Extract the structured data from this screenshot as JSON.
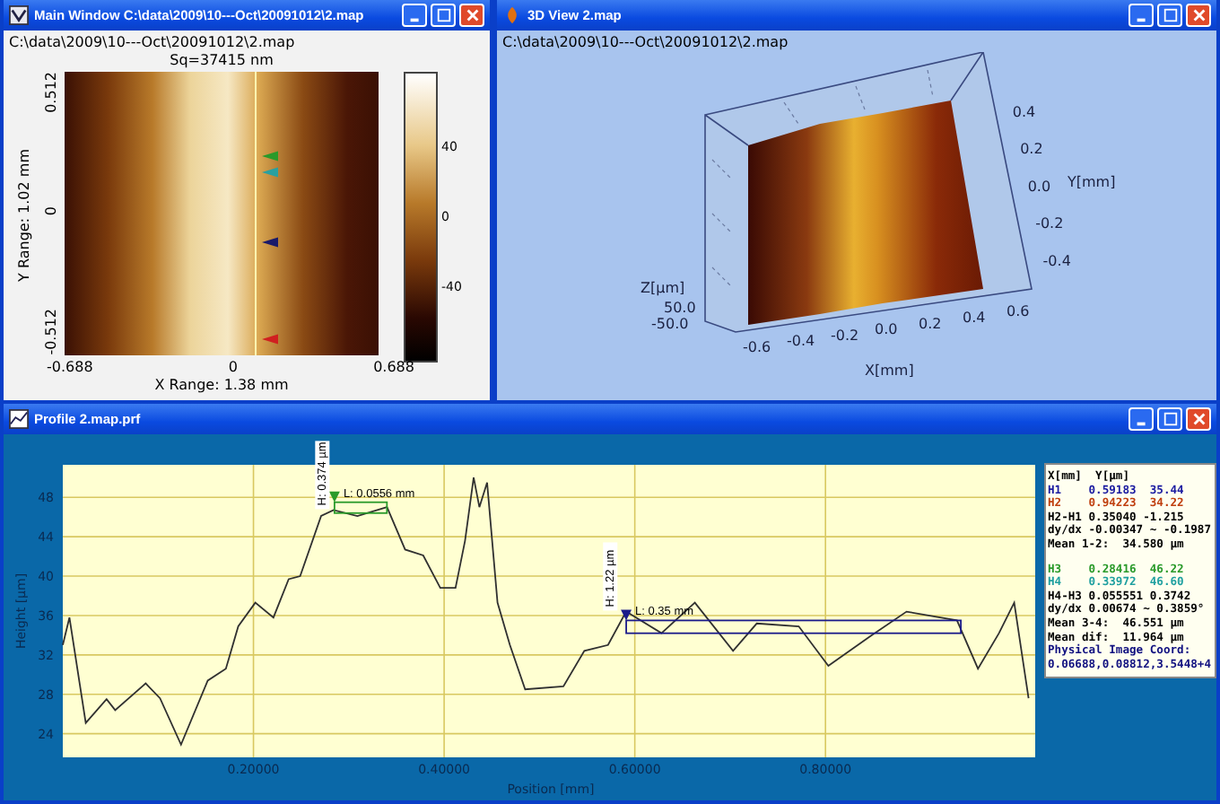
{
  "main_window": {
    "title": "Main Window C:\\data\\2009\\10---Oct\\20091012\\2.map",
    "path": "C:\\data\\2009\\10---Oct\\20091012\\2.map",
    "image_title": "Sq=37415 nm",
    "y_axis_label": "Y Range: 1.02 mm",
    "y_ticks": [
      "0.512",
      "0",
      "-0.512"
    ],
    "x_ticks": [
      "-0.688",
      "0",
      "0.688"
    ],
    "x_axis_label": "X Range: 1.38 mm",
    "cursor_markers": [
      {
        "color": "#2a9a2a"
      },
      {
        "color": "#2aa0a0"
      },
      {
        "color": "#1a1a6a"
      },
      {
        "color": "#d02020"
      }
    ],
    "color_scale_ticks": [
      "40",
      "0",
      "-40"
    ]
  },
  "view_3d": {
    "title": "3D View 2.map",
    "path": "C:\\data\\2009\\10---Oct\\20091012\\2.map",
    "y_ticks": [
      "0.4",
      "0.2",
      "0.0",
      "-0.2",
      "-0.4"
    ],
    "y_axis_label": "Y[mm]",
    "x_ticks": [
      "-0.6",
      "-0.4",
      "-0.2",
      "0.0",
      "0.2",
      "0.4",
      "0.6"
    ],
    "x_axis_label": "X[mm]",
    "z_axis_label": "Z[µm]",
    "z_ticks": [
      "50.0",
      "-50.0"
    ]
  },
  "profile_window": {
    "title": "Profile 2.map.prf",
    "chart_data": {
      "type": "line",
      "xlabel": "Position [mm]",
      "ylabel": "Height [µm]",
      "x": [
        0,
        0.007,
        0.024,
        0.046,
        0.055,
        0.087,
        0.102,
        0.124,
        0.152,
        0.171,
        0.184,
        0.202,
        0.221,
        0.237,
        0.249,
        0.271,
        0.284,
        0.309,
        0.34,
        0.359,
        0.378,
        0.396,
        0.412,
        0.422,
        0.431,
        0.437,
        0.445,
        0.456,
        0.469,
        0.485,
        0.525,
        0.547,
        0.572,
        0.591,
        0.628,
        0.663,
        0.703,
        0.728,
        0.772,
        0.803,
        0.847,
        0.885,
        0.938,
        0.96,
        0.982,
        0.998,
        1.013
      ],
      "series": [
        {
          "color": "#303030",
          "values": [
            33.0,
            35.8,
            25.1,
            27.5,
            26.4,
            29.1,
            27.6,
            22.9,
            29.4,
            30.6,
            34.9,
            37.3,
            35.8,
            39.7,
            40.0,
            46.1,
            46.7,
            46.1,
            47.0,
            42.7,
            42.1,
            38.8,
            38.8,
            43.6,
            50.0,
            47.0,
            49.5,
            37.3,
            33.0,
            28.5,
            28.8,
            32.4,
            33.0,
            36.4,
            34.2,
            37.3,
            32.4,
            35.2,
            34.9,
            30.9,
            33.9,
            36.4,
            35.5,
            30.6,
            34.2,
            37.3,
            27.6
          ]
        }
      ],
      "xlim": [
        0,
        1.02
      ],
      "ylim": [
        21.6,
        51.3
      ],
      "xticks": [
        {
          "value": 0.2,
          "label": "0.20000"
        },
        {
          "value": 0.4,
          "label": "0.40000"
        },
        {
          "value": 0.6,
          "label": "0.60000"
        },
        {
          "value": 0.8,
          "label": "0.80000"
        }
      ],
      "yticks": [
        24,
        28,
        32,
        36,
        40,
        44,
        48
      ],
      "grid": true,
      "annotations": [
        {
          "text": "H: 0.374 µm",
          "x": 0.276,
          "y": 46.8
        },
        {
          "text": "L: 0.0556 mm",
          "x": 0.285,
          "y": 47.5
        },
        {
          "text": "H: 1.22 µm",
          "x": 0.578,
          "y": 36.5
        },
        {
          "text": "L: 0.35 mm",
          "x": 0.591,
          "y": 35.5
        }
      ]
    },
    "measurement_brackets": [
      {
        "color": "#2a9a2a"
      },
      {
        "color": "#1a1a8a"
      }
    ],
    "readout": [
      [
        {
          "text": "X[mm]  Y[µm]",
          "color": "#000000"
        },
        {
          "text": "H1    0.59183  35.44",
          "color": "#1a1aa0"
        },
        {
          "text": "H2    0.94223  34.22",
          "color": "#c04010"
        },
        {
          "text": "H2-H1 0.35040 -1.215",
          "color": "#000000"
        },
        {
          "text": "dy/dx -0.00347 ~ -0.1987",
          "color": "#000000"
        },
        {
          "text": "Mean 1-2:  34.580 µm",
          "color": "#000000"
        }
      ],
      [
        {
          "text": "H3    0.28416  46.22",
          "color": "#2a9a2a"
        },
        {
          "text": "H4    0.33972  46.60",
          "color": "#20a0a0"
        },
        {
          "text": "H4-H3 0.055551 0.3742",
          "color": "#000000"
        },
        {
          "text": "dy/dx 0.00674 ~ 0.3859°",
          "color": "#000000"
        },
        {
          "text": "Mean 3-4:  46.551 µm",
          "color": "#000000"
        },
        {
          "text": "Mean dif:  11.964 µm",
          "color": "#000000"
        },
        {
          "text": "Physical Image Coord:",
          "color": "#101080"
        },
        {
          "text": "0.06688,0.08812,3.5448+4",
          "color": "#101080"
        }
      ]
    ]
  }
}
